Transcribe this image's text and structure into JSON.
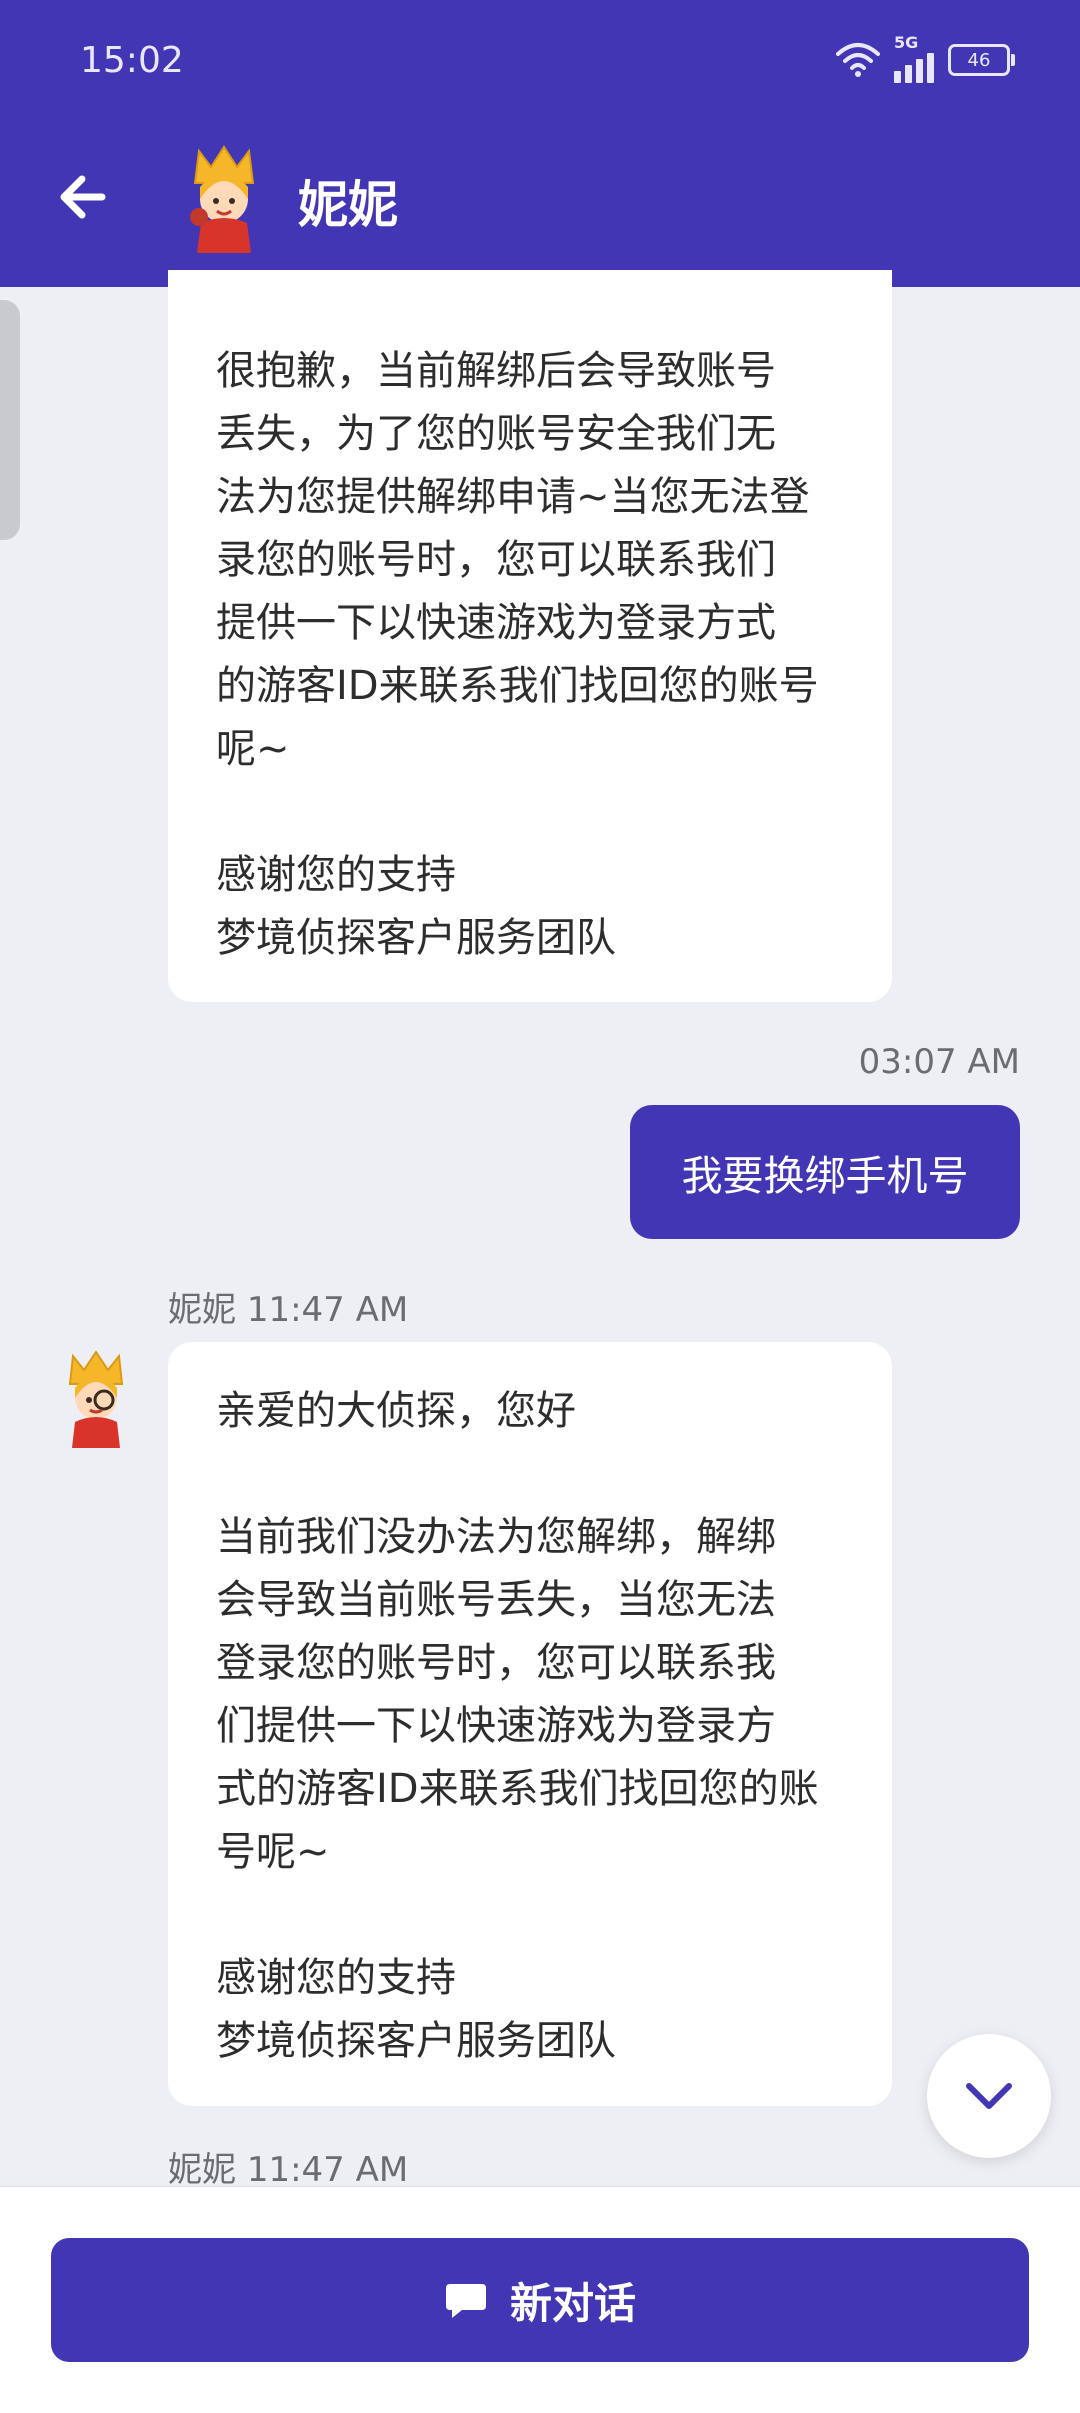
{
  "status_bar": {
    "time": "15:02",
    "network": "5G",
    "battery": "46"
  },
  "header": {
    "title": "妮妮"
  },
  "messages": {
    "agent_1": {
      "text": "很抱歉，当前解绑后会导致账号\n丢失，为了您的账号安全我们无\n法为您提供解绑申请~当您无法登\n录您的账号时，您可以联系我们\n提供一下以快速游戏为登录方式\n的游客ID来联系我们找回您的账号\n呢~\n\n感谢您的支持\n梦境侦探客户服务团队"
    },
    "user_1": {
      "time": "03:07 AM",
      "text": "我要换绑手机号"
    },
    "agent_2": {
      "sender": "妮妮",
      "time": "11:47 AM",
      "text": "亲爱的大侦探，您好\n\n当前我们没办法为您解绑，解绑\n会导致当前账号丢失，当您无法\n登录您的账号时，您可以联系我\n们提供一下以快速游戏为登录方\n式的游客ID来联系我们找回您的账\n号呢~\n\n感谢您的支持\n梦境侦探客户服务团队"
    },
    "agent_3": {
      "sender": "妮妮",
      "time": "11:47 AM"
    }
  },
  "bottom": {
    "new_chat_label": "新对话"
  },
  "icons": {
    "back": "arrow-left-icon",
    "scroll": "chevron-down-icon",
    "chat": "chat-bubble-icon",
    "avatar": "crown-detective-avatar"
  },
  "colors": {
    "brand": "#4336b4",
    "background": "#eeeff4"
  }
}
